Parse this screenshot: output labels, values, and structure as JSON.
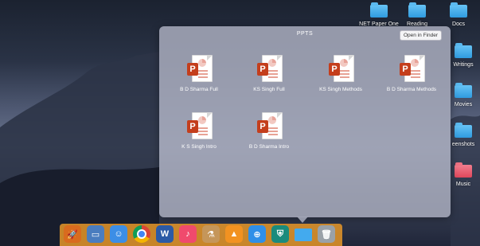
{
  "desktop": {
    "items": [
      {
        "label": "NET Paper One",
        "type": "folder"
      },
      {
        "label": "Reading",
        "type": "folder"
      },
      {
        "label": "Docs",
        "type": "folder"
      },
      {
        "label": "Writings",
        "type": "folder"
      },
      {
        "label": "Movies",
        "type": "folder"
      },
      {
        "label": "eenshots",
        "type": "folder"
      },
      {
        "label": "Music",
        "type": "music-folder"
      }
    ]
  },
  "stack": {
    "title": "PPTS",
    "open_in_finder_label": "Open in Finder",
    "files": [
      {
        "name": "B D Sharma Full",
        "icon": "powerpoint-file-icon"
      },
      {
        "name": "KS Singh Full",
        "icon": "powerpoint-file-icon"
      },
      {
        "name": "KS Singh Methods",
        "icon": "powerpoint-file-icon"
      },
      {
        "name": "B D Sharma Methods",
        "icon": "powerpoint-file-icon"
      },
      {
        "name": "K S Singh Intro",
        "icon": "powerpoint-file-icon"
      },
      {
        "name": "B D Sharma Intro",
        "icon": "powerpoint-file-icon"
      }
    ],
    "badge_letter": "P"
  },
  "dock": {
    "apps": [
      {
        "name": "launchpad-icon",
        "glyph": "🚀",
        "color": "#d96b1e"
      },
      {
        "name": "photos-icon",
        "glyph": "▭",
        "color": "#4a7dbf"
      },
      {
        "name": "finder-icon",
        "glyph": "☺",
        "color": "#3c8ee6"
      },
      {
        "name": "chrome-icon",
        "glyph": "●",
        "color": "#ffffff"
      },
      {
        "name": "word-icon",
        "glyph": "W",
        "color": "#2b5aa6"
      },
      {
        "name": "itunes-icon",
        "glyph": "♪",
        "color": "#f04a6d"
      },
      {
        "name": "automator-icon",
        "glyph": "⚗",
        "color": "#c5965a"
      },
      {
        "name": "vlc-icon",
        "glyph": "▲",
        "color": "#f29221"
      },
      {
        "name": "safari-icon",
        "glyph": "⊕",
        "color": "#2f8fe8"
      },
      {
        "name": "shield-app-icon",
        "glyph": "⛨",
        "color": "#1a8b7c"
      },
      {
        "name": "ppts-folder-icon",
        "glyph": "",
        "color": "#43aaee"
      },
      {
        "name": "trash-icon",
        "glyph": "🗑",
        "color": "#9aa1a8"
      }
    ]
  },
  "colors": {
    "dock": "#e6962a",
    "ppt_badge": "#c43e1c",
    "folder_blue": "#43aaee"
  }
}
